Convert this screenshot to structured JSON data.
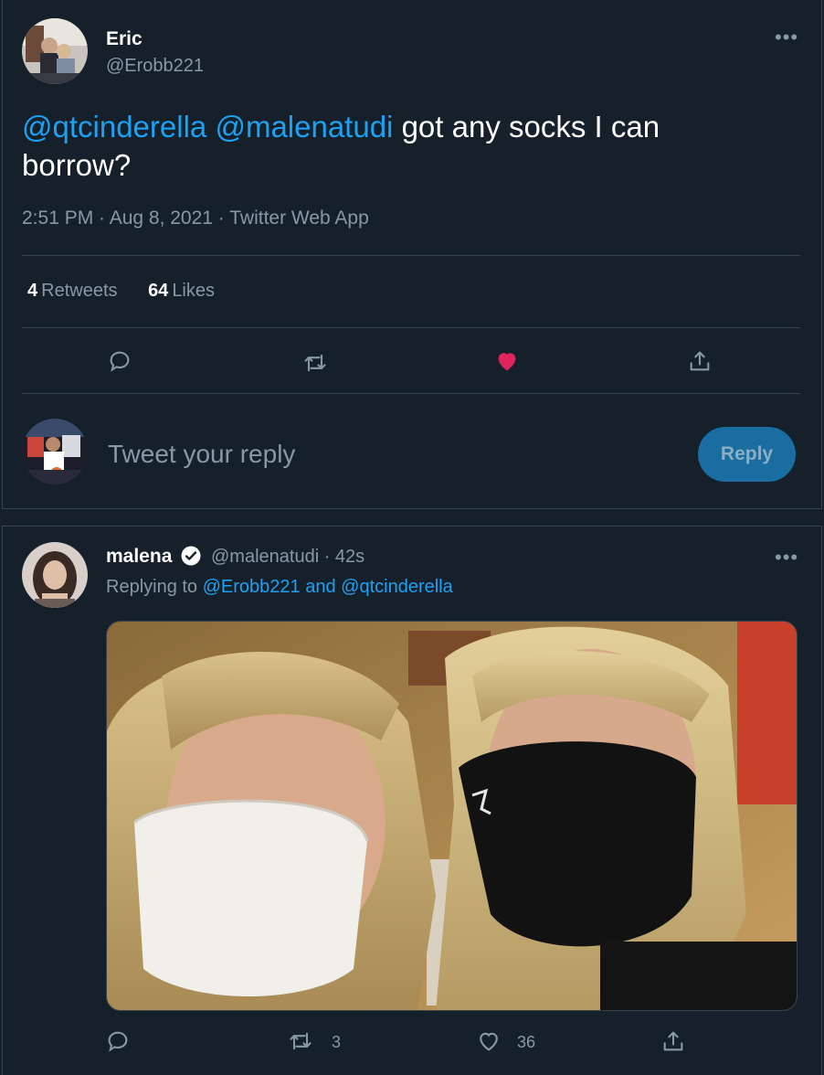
{
  "main_tweet": {
    "author_name": "Eric",
    "author_handle": "@Erobb221",
    "more_label": "•••",
    "mention_1": "@qtcinderella",
    "mention_2": "@malenatudi",
    "text": " got any socks I can borrow?",
    "timestamp": "2:51 PM · Aug 8, 2021 · Twitter Web App",
    "retweets_count": "4",
    "retweets_label": "Retweets",
    "likes_count": "64",
    "likes_label": "Likes",
    "liked": true
  },
  "composer": {
    "placeholder": "Tweet your reply",
    "reply_button_label": "Reply"
  },
  "reply_tweet": {
    "author_name": "malena",
    "verified": true,
    "author_handle": "@malenatudi",
    "time": " · 42s",
    "more_label": "•••",
    "replying_prefix": "Replying to ",
    "replying_mention_1": "@Erobb221",
    "replying_and": " and ",
    "replying_mention_2": "@qtcinderella",
    "retweet_count": "3",
    "like_count": "36"
  },
  "colors": {
    "background": "#15202b",
    "border": "#38444d",
    "accent": "#1da1f2",
    "muted": "#8899a6",
    "like": "#e0245e"
  }
}
